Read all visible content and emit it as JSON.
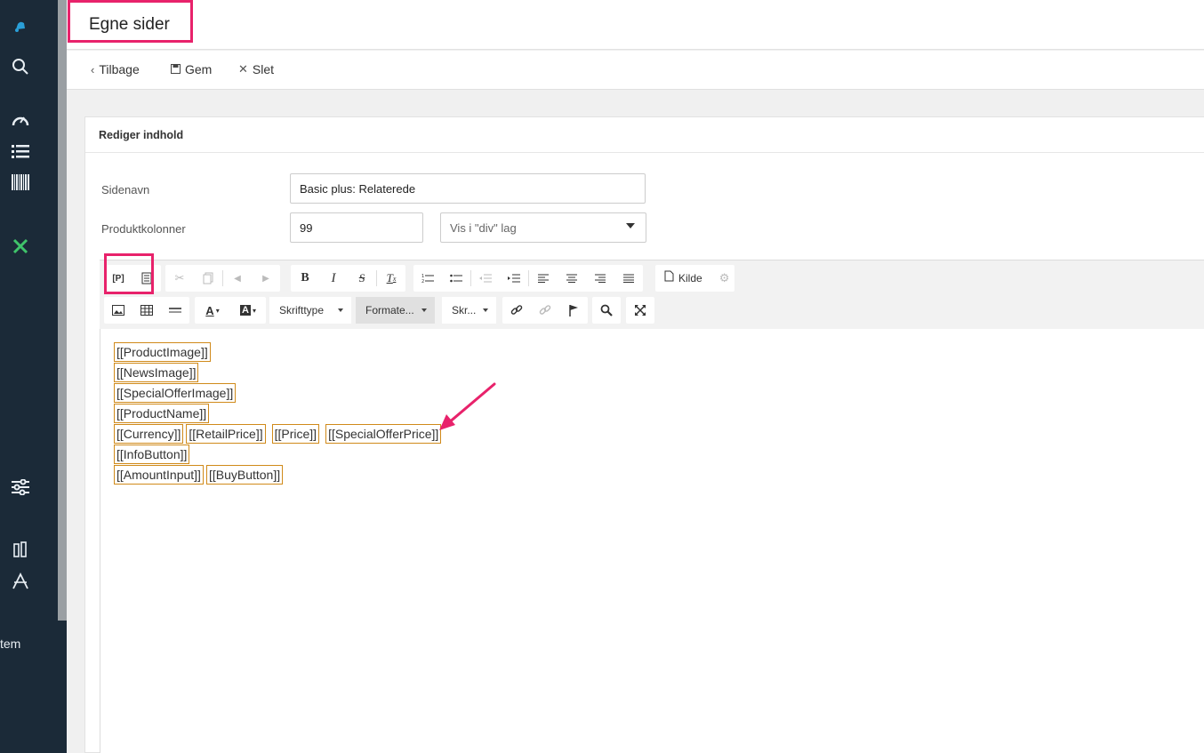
{
  "sidebar": {
    "icons": [
      "bell-icon",
      "search-icon",
      "speedometer-icon",
      "list-icon",
      "barcode-icon",
      "tools-icon",
      "sliders-icon",
      "pencil-icon",
      "font-icon"
    ],
    "bottom_text": "tem"
  },
  "header": {
    "title": "Egne sider"
  },
  "toolbar": {
    "back": "Tilbage",
    "save": "Gem",
    "delete": "Slet"
  },
  "panel": {
    "title": "Rediger indhold",
    "fields": {
      "page_name_label": "Sidenavn",
      "page_name_value": "Basic plus: Relaterede",
      "columns_label": "Produktkolonner",
      "columns_value": "99",
      "layout_value": "Vis i \"div\" lag"
    }
  },
  "editor": {
    "toolbar": {
      "p_button": "[P]",
      "source_label": "Kilde",
      "font_label": "Skrifttype",
      "format_label": "Formate...",
      "size_label": "Skr..."
    },
    "lines": [
      [
        "[[ProductImage]]"
      ],
      [
        "[[NewsImage]]"
      ],
      [
        "[[SpecialOfferImage]]"
      ],
      [
        "[[ProductName]]"
      ],
      [
        "[[Currency]]",
        "[[RetailPrice]]",
        "[[Price]]",
        "[[SpecialOfferPrice]]"
      ],
      [
        "[[InfoButton]]"
      ],
      [
        "[[AmountInput]]",
        "[[BuyButton]]"
      ]
    ]
  },
  "colors": {
    "highlight": "#e8226b",
    "tag_border": "#d08a1a",
    "sidebar": "#1b2a38"
  }
}
